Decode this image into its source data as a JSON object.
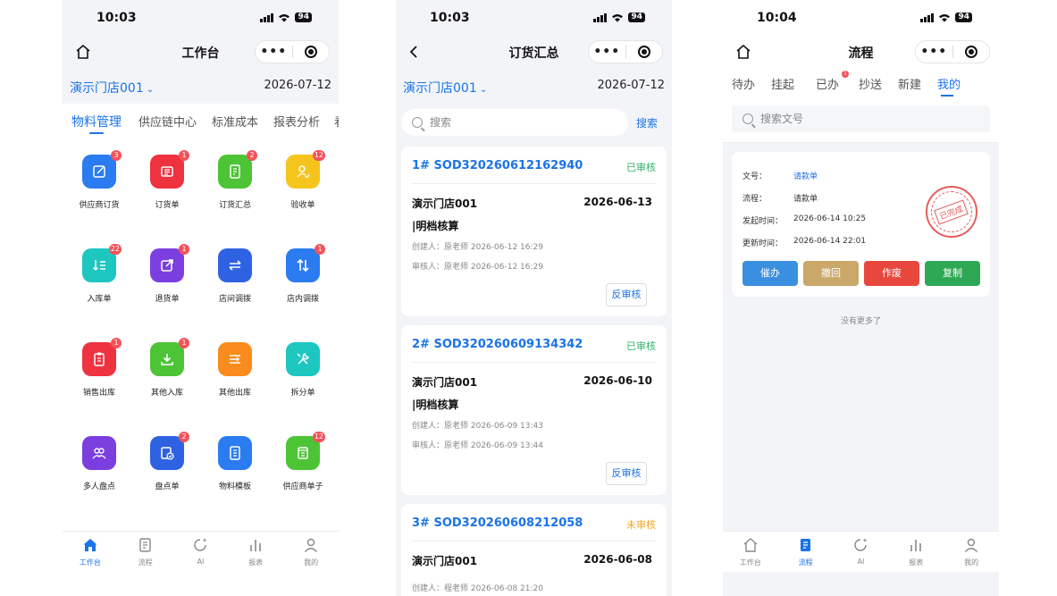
{
  "colors": {
    "accent": "#1a73e8",
    "ok": "#34b26a",
    "pending": "#f5a623",
    "badge": "#f4525a"
  },
  "phone1": {
    "time": "10:03",
    "battery": "94",
    "title": "工作台",
    "store": "演示门店001",
    "date": "2026-07-12",
    "tabs": [
      "物料管理",
      "供应链中心",
      "标准成本",
      "报表分析",
      "看"
    ],
    "grid": [
      {
        "label": "供应商订货",
        "badge": "3",
        "color": "#2a7cf0",
        "icon": "edit-icon"
      },
      {
        "label": "订货单",
        "badge": "1",
        "color": "#ee3240",
        "icon": "receipt-icon"
      },
      {
        "label": "订货汇总",
        "badge": "2",
        "color": "#4cc436",
        "icon": "document-icon"
      },
      {
        "label": "验收单",
        "badge": "12",
        "color": "#f6c51d",
        "icon": "user-check-icon"
      },
      {
        "label": "入库单",
        "badge": "22",
        "color": "#1ec6c0",
        "icon": "inbound-list-icon"
      },
      {
        "label": "退货单",
        "badge": "1",
        "color": "#7b3fe0",
        "icon": "export-icon"
      },
      {
        "label": "店间调拨",
        "badge": "",
        "color": "#2f62e3",
        "icon": "swap-icon"
      },
      {
        "label": "店内调拨",
        "badge": "1",
        "color": "#2a7cf0",
        "icon": "up-down-icon"
      },
      {
        "label": "销售出库",
        "badge": "1",
        "color": "#ee3240",
        "icon": "clipboard-icon"
      },
      {
        "label": "其他入库",
        "badge": "1",
        "color": "#4cc436",
        "icon": "download-icon"
      },
      {
        "label": "其他出库",
        "badge": "",
        "color": "#f98c1c",
        "icon": "list-out-icon"
      },
      {
        "label": "拆分单",
        "badge": "",
        "color": "#1ec6c0",
        "icon": "tools-icon"
      },
      {
        "label": "多人盘点",
        "badge": "",
        "color": "#7b3fe0",
        "icon": "users-icon"
      },
      {
        "label": "盘点单",
        "badge": "2",
        "color": "#2f62e3",
        "icon": "check-doc-icon"
      },
      {
        "label": "物料模板",
        "badge": "",
        "color": "#2a7cf0",
        "icon": "template-icon"
      },
      {
        "label": "供应商单子",
        "badge": "12",
        "color": "#4cc436",
        "icon": "note-icon"
      }
    ]
  },
  "tabbar": [
    "工作台",
    "流程",
    "AI",
    "报表",
    "我的"
  ],
  "phone2": {
    "time": "10:03",
    "battery": "94",
    "title": "订货汇总",
    "store": "演示门店001",
    "date": "2026-07-12",
    "search_placeholder": "搜索",
    "search_button": "搜索",
    "orders": [
      {
        "no": "1# SOD320260612162940",
        "status": "已审核",
        "store": "演示门店001",
        "date": "2026-06-13",
        "method": "|明档核算",
        "creator": "创建人：原老师 2026-06-12 16:29",
        "reviewer": "审核人：原老师 2026-06-12 16:29",
        "action": "反审核"
      },
      {
        "no": "2# SOD320260609134342",
        "status": "已审核",
        "store": "演示门店001",
        "date": "2026-06-10",
        "method": "|明档核算",
        "creator": "创建人：原老师 2026-06-09 13:43",
        "reviewer": "审核人：原老师 2026-06-09 13:44",
        "action": "反审核"
      },
      {
        "no": "3# SOD320260608212058",
        "status": "未审核",
        "store": "演示门店001",
        "date": "2026-06-08",
        "creator": "创建人：程老师 2026-06-08 21:20"
      }
    ]
  },
  "phone3": {
    "time": "10:04",
    "battery": "94",
    "title": "流程",
    "tabs": [
      "待办",
      "挂起",
      "已办",
      "抄送",
      "新建",
      "我的"
    ],
    "tab_badge": "1",
    "search_placeholder": "搜索文号",
    "doc": {
      "no_label": "文号：",
      "no_value": "请款单",
      "flow_label": "流程：",
      "flow_value": "请款单",
      "start_label": "发起时间：",
      "start_value": "2026-06-14 10:25",
      "update_label": "更新时间：",
      "update_value": "2026-06-14 22:01",
      "stamp": "已完成"
    },
    "actions": [
      {
        "label": "催办",
        "color": "#3b8fe0"
      },
      {
        "label": "撤回",
        "color": "#c9a86a"
      },
      {
        "label": "作废",
        "color": "#e8473d"
      },
      {
        "label": "复制",
        "color": "#2fa855"
      }
    ],
    "no_more": "没有更多了"
  }
}
